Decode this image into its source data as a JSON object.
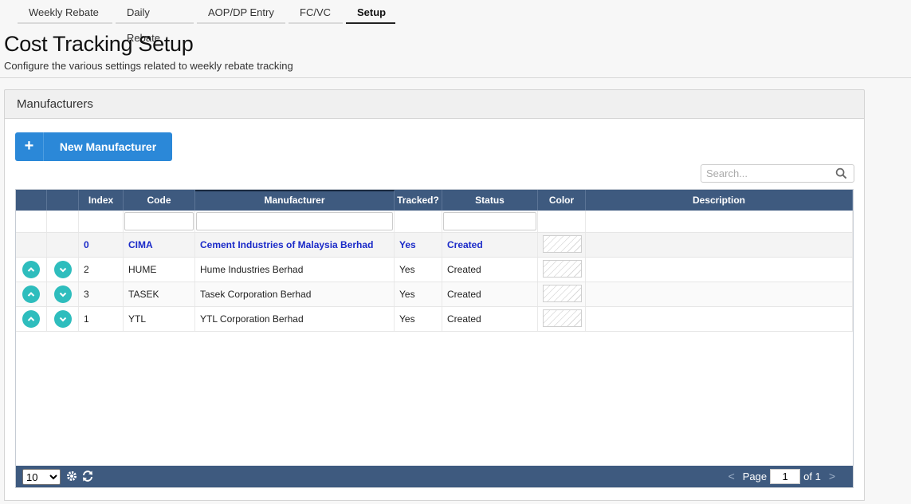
{
  "tabs": [
    "Weekly Rebate",
    "Daily Rebate",
    "AOP/DP Entry",
    "FC/VC",
    "Setup"
  ],
  "active_tab": "Setup",
  "page": {
    "title": "Cost Tracking Setup",
    "subtitle": "Configure the various settings related to weekly rebate tracking"
  },
  "panel": {
    "title": "Manufacturers"
  },
  "toolbar": {
    "new_button_label": "New Manufacturer"
  },
  "search": {
    "placeholder": "Search...",
    "value": ""
  },
  "grid": {
    "columns": [
      "",
      "",
      "Index",
      "Code",
      "Manufacturer",
      "Tracked?",
      "Status",
      "Color",
      "Description"
    ],
    "sorted_column": "Manufacturer",
    "rows": [
      {
        "index": "0",
        "code": "CIMA",
        "manufacturer": "Cement Industries of Malaysia Berhad",
        "tracked": "Yes",
        "status": "Created",
        "description": "",
        "selected": true
      },
      {
        "index": "2",
        "code": "HUME",
        "manufacturer": "Hume Industries Berhad",
        "tracked": "Yes",
        "status": "Created",
        "description": ""
      },
      {
        "index": "3",
        "code": "TASEK",
        "manufacturer": "Tasek Corporation Berhad",
        "tracked": "Yes",
        "status": "Created",
        "description": ""
      },
      {
        "index": "1",
        "code": "YTL",
        "manufacturer": "YTL Corporation Berhad",
        "tracked": "Yes",
        "status": "Created",
        "description": ""
      }
    ]
  },
  "footer": {
    "page_size": "10",
    "page_label": "Page",
    "page_value": "1",
    "of_label": "of 1",
    "prev": "<",
    "next": ">"
  },
  "colors": {
    "accent": "#2b88d8",
    "grid_header": "#3e5a7f",
    "move_button": "#2ebdbd",
    "selected_text": "#1a2ac8"
  }
}
